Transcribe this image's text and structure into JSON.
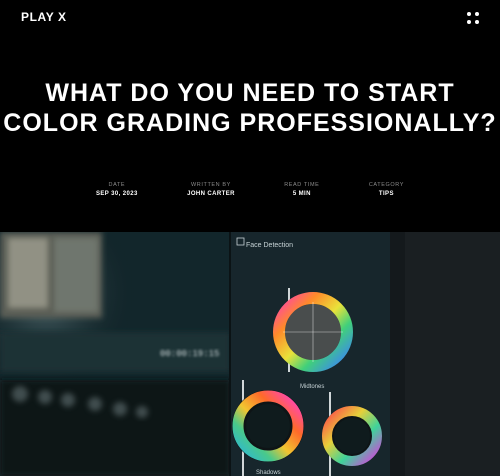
{
  "site": {
    "logo": "PLAY X"
  },
  "header": {
    "menu_icon": "grid-dots-icon"
  },
  "article": {
    "title": "WHAT DO YOU NEED TO START COLOR GRADING PROFESSIONALLY?",
    "meta": [
      {
        "label": "DATE",
        "value": "SEP 30, 2023"
      },
      {
        "label": "WRITTEN BY",
        "value": "JOHN CARTER"
      },
      {
        "label": "READ TIME",
        "value": "5 MIN"
      },
      {
        "label": "CATEGORY",
        "value": "TIPS"
      }
    ]
  },
  "hero_image": {
    "labels": {
      "face_detection": "Face Detection",
      "midtones": "Midtones",
      "shadows": "Shadows"
    },
    "timecode": "00:00:19:15"
  },
  "colors": {
    "background": "#000000",
    "text": "#ffffff",
    "meta_label": "#8a8a8a"
  }
}
